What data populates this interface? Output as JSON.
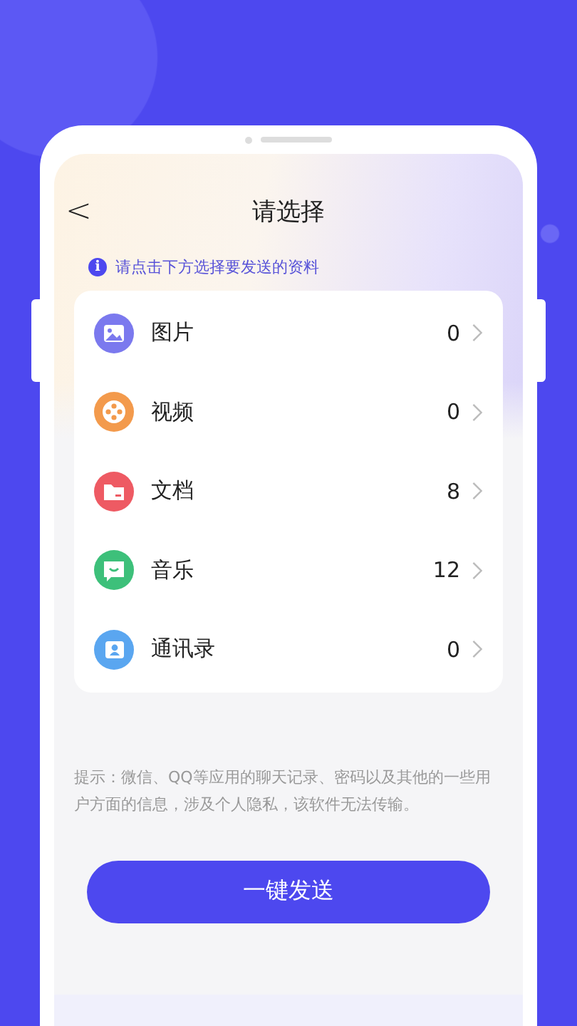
{
  "header": {
    "back": "<",
    "title": "请选择"
  },
  "notice": {
    "icon": "i",
    "text": "请点击下方选择要发送的资料"
  },
  "items": [
    {
      "kind": "image",
      "label": "图片",
      "count": "0",
      "color": "#7b79ee"
    },
    {
      "kind": "video",
      "label": "视频",
      "count": "0",
      "color": "#f39a4c"
    },
    {
      "kind": "folder",
      "label": "文档",
      "count": "8",
      "color": "#ee5a63"
    },
    {
      "kind": "chat",
      "label": "音乐",
      "count": "12",
      "color": "#3dc07a"
    },
    {
      "kind": "contacts",
      "label": "通讯录",
      "count": "0",
      "color": "#5aa6f0"
    }
  ],
  "hint": "提示：微信、QQ等应用的聊天记录、密码以及其他的一些用户方面的信息，涉及个人隐私，该软件无法传输。",
  "button": "一键发送"
}
